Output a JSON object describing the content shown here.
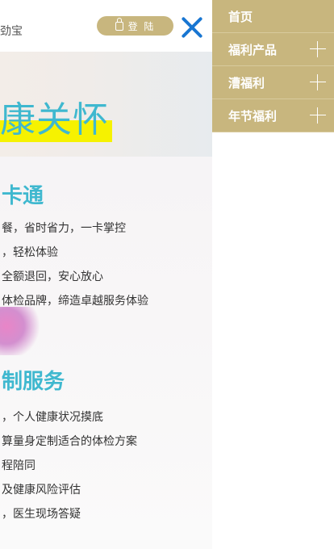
{
  "header": {
    "brand_fragment": "劲宝",
    "login_label": "登 陆",
    "close_icon": "close-x-icon",
    "close_color": "#1876d2"
  },
  "hero": {
    "title": "康关怀",
    "title_color": "#3fb8cf",
    "highlight_color": "#f6f200"
  },
  "section1": {
    "title": "卡通",
    "items": [
      "餐，省时省力，一卡掌控",
      "，轻松体验",
      "全额退回，安心放心",
      "体检品牌，缔造卓越服务体验"
    ]
  },
  "section2": {
    "title": "制服务",
    "items": [
      "，个人健康状况摸底",
      "算量身定制适合的体检方案",
      "程陪同",
      "及健康风险评估",
      "，医生现场答疑"
    ]
  },
  "menu": {
    "background": "#c8b67e",
    "items": [
      {
        "label": "首页",
        "expandable": false
      },
      {
        "label": "福利产品",
        "expandable": true
      },
      {
        "label": "漕福利",
        "expandable": true
      },
      {
        "label": "年节福利",
        "expandable": true
      }
    ]
  }
}
